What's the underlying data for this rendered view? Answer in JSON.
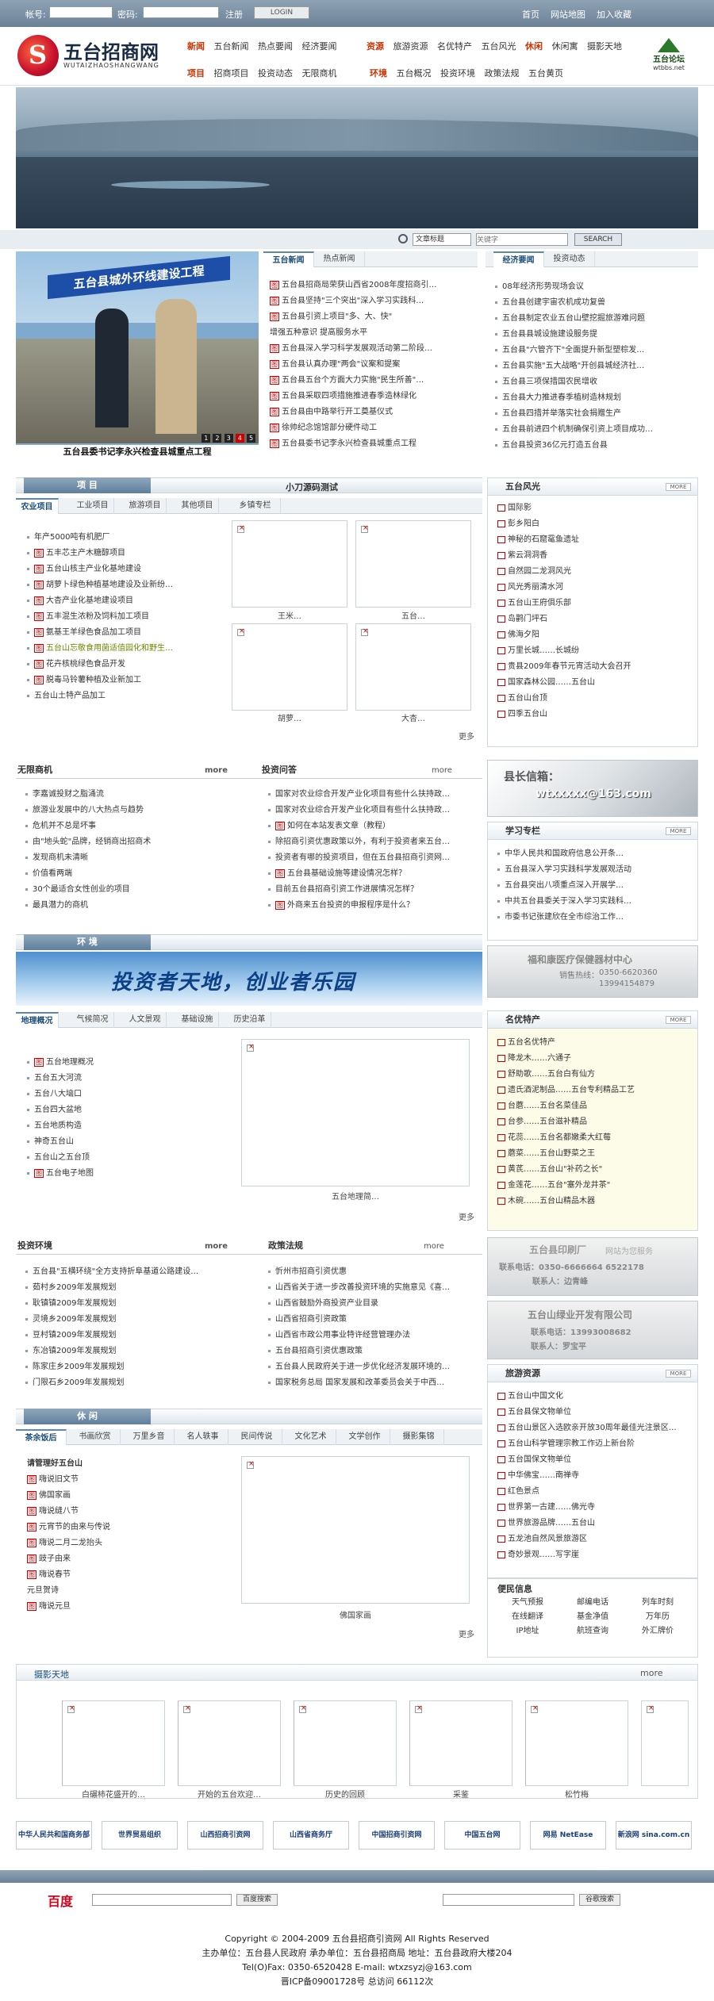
{
  "topbar": {
    "account_label": "帐号:",
    "password_label": "密码:",
    "register": "注册",
    "login": "LOGIN",
    "home": "首页",
    "sitemap": "网站地图",
    "favorite": "加入收藏"
  },
  "header": {
    "logo_title": "五台招商网",
    "logo_sub": "WUTAIZHAOSHANGWANG",
    "nav1_cat": "新闻",
    "nav1": [
      "五台新闻",
      "热点要闻",
      "经济要闻"
    ],
    "nav1b_cat": "资源",
    "nav1b": [
      "旅游资源",
      "名优特产",
      "五台风光"
    ],
    "nav1c_cat": "休闲",
    "nav1c": [
      "休闲寓",
      "摄影天地"
    ],
    "nav2_cat": "项目",
    "nav2": [
      "招商项目",
      "投资动态",
      "无限商机"
    ],
    "nav2b_cat": "环境",
    "nav2b": [
      "五台概况",
      "投资环境",
      "政策法规",
      "五台黄页"
    ],
    "right_logo": "五台论坛",
    "right_logo_sub": "wtbbs.net"
  },
  "search": {
    "select": "文章标题",
    "placeholder": "关键字",
    "button": "SEARCH"
  },
  "photo": {
    "sign": "五台县城外环线建设工程",
    "caption": "五台县委书记李永兴检查县城重点工程",
    "pages": [
      "1",
      "2",
      "3",
      "4",
      "5"
    ],
    "active_page": 3
  },
  "news": {
    "tabs": [
      "五台新闻",
      "热点新闻"
    ],
    "items": [
      {
        "tag": "图",
        "t": "五台县招商局荣获山西省2008年度招商引…"
      },
      {
        "tag": "图",
        "t": "五台县坚持\"三个突出\"深入学习实践科…"
      },
      {
        "tag": "图",
        "t": "五台县引资上项目\"多、大、快\""
      },
      {
        "tag": "",
        "t": "增强五种意识 提高服务水平"
      },
      {
        "tag": "图",
        "t": "五台县深入学习科学发展观活动第二阶段…"
      },
      {
        "tag": "图",
        "t": "五台县认真办理\"两会\"议案和提案"
      },
      {
        "tag": "图",
        "t": "五台县五台个方面大力实施\"民生所善\"…"
      },
      {
        "tag": "图",
        "t": "五台县采取四项措施推进春季造林绿化"
      },
      {
        "tag": "图",
        "t": "五台县由中路举行开工奠基仪式"
      },
      {
        "tag": "图",
        "t": "徐帅纪念馆馆部分硬件动工"
      },
      {
        "tag": "图",
        "t": "五台县委书记李永兴检查县城重点工程"
      }
    ]
  },
  "econ": {
    "tabs": [
      "经济要闻",
      "投资动态"
    ],
    "items": [
      "08年经济形势现场会议",
      "五台县创建宇宙农机成功复兽",
      "五台县制定农业五台山壁挖掘旅游难问题",
      "五台县县城设施建设服务提",
      "五台县\"六管齐下\"全面提升新型塑棕发…",
      "五台县实施\"五大战略\"开创县城经济社…",
      "五台县三项保措国农民增收",
      "五台县大力推进春季植树造林规划",
      "五台县四措并举落实社会捐赠生产",
      "五台县前进四个机制确保引资上项目成功…",
      "五台县投资36亿元打造五台县"
    ]
  },
  "projects": {
    "band": "项  目",
    "center_title": "小刀源码测试",
    "tabs": [
      "农业项目",
      "工业项目",
      "旅游项目",
      "其他项目",
      "乡镇专栏"
    ],
    "items": [
      {
        "tag": "",
        "t": "年产5000吨有机肥厂"
      },
      {
        "tag": "图",
        "t": "五丰芯主产木糖醇项目"
      },
      {
        "tag": "图",
        "t": "五台山核主产业化基地建设"
      },
      {
        "tag": "图",
        "t": "胡萝卜绿色种植基地建设及业新纷…"
      },
      {
        "tag": "图",
        "t": "大杏产业化基地建设项目"
      },
      {
        "tag": "图",
        "t": "五丰混生浓粉及饲料加工项目"
      },
      {
        "tag": "图",
        "t": "氨基王羊绿色食品加工项目"
      },
      {
        "tag": "图",
        "t": "五台山忘敬食用菌适值园化和野生…",
        "hl": true
      },
      {
        "tag": "图",
        "t": "花卉核桃绿色食品开发"
      },
      {
        "tag": "图",
        "t": "脱毒马铃薯种植及业新加工"
      },
      {
        "tag": "",
        "t": "五台山土特产品加工"
      }
    ],
    "thumbs": [
      "王米…",
      "五台…",
      "胡萝…",
      "大杏…"
    ],
    "more": "更多"
  },
  "scenic": {
    "title": "五台风光",
    "morebtn": "MORE",
    "items": [
      "国际影",
      "彭乡阳白",
      "神秘的石窟鼋鱼遗址",
      "紫云洞洞香",
      "自然园二龙洞风光",
      "风光秀丽清水河",
      "五台山王府俱乐部",
      "岛鹳门坪石",
      "佛海夕阳",
      "万里长城……长城纷",
      "贵县2009年春节元宵活动大会召开",
      "国家森林公园……五台山",
      "五台山台顶",
      "四季五台山"
    ]
  },
  "opps": {
    "title": "无限商机",
    "more": "more",
    "items": [
      "李嘉诚投财之脂涌流",
      "旅游业发展中的八大热点与趋势",
      "危机并不总是坏事",
      "由\"地头蛇\"品牌，经销商出招商术",
      "发现商机未清晰",
      "价值看两端",
      "30个最适合女性创业的项目",
      "最具潜力的商机"
    ]
  },
  "invq": {
    "title": "投资问答",
    "more": "more",
    "items": [
      {
        "tag": "",
        "t": "国家对农业综合开发产业化项目有些什么扶持政…"
      },
      {
        "tag": "",
        "t": "国家对农业综合开发产业化项目有些什么扶持政…"
      },
      {
        "tag": "图",
        "t": "如何在本站发表文章（教程）"
      },
      {
        "tag": "",
        "t": "除招商引资优惠政策以外，有利于投资者来五台…"
      },
      {
        "tag": "",
        "t": "投资者有哪的投资项目，但在五台县招商引资网…"
      },
      {
        "tag": "图",
        "t": "五台县基础设施等建设情况怎样？"
      },
      {
        "tag": "",
        "t": "目前五台县招商引资工作进展情况怎样？"
      },
      {
        "tag": "图",
        "t": "外商来五台投资的申报程序是什么？"
      }
    ]
  },
  "ad1": {
    "title": "县长信箱：",
    "email": "wtxxxxx@163.com"
  },
  "study": {
    "title": "学习专栏",
    "morebtn": "MORE",
    "items": [
      "中华人民共和国政府信息公开条…",
      "五台县深入学习实践科学发展观活动",
      "五台县突出八项重点深入开展学…",
      "中共五台县委关于深入学习实践科…",
      "市委书记张建欣在全市综治工作…"
    ]
  },
  "ad2": {
    "title": "福和康医疗保健器材中心",
    "line1": "销售热线：",
    "tel1": "0350-6620360",
    "tel2": "13994154879"
  },
  "env_band": "环  境",
  "env_banner": "投资者天地，创业者乐园",
  "geo": {
    "tabs": [
      "地理概况",
      "气候简况",
      "人文景观",
      "基础设施",
      "历史沿革"
    ],
    "items": [
      {
        "tag": "图",
        "t": "五台地理概况"
      },
      {
        "tag": "",
        "t": "五台五大河流"
      },
      {
        "tag": "",
        "t": "五台八大垴口"
      },
      {
        "tag": "",
        "t": "五台四大盆地"
      },
      {
        "tag": "",
        "t": "五台地质构造"
      },
      {
        "tag": "",
        "t": "神奇五台山"
      },
      {
        "tag": "",
        "t": "五台山之五台顶"
      },
      {
        "tag": "图",
        "t": "五台电子地图"
      }
    ],
    "thumb": "五台地理简…",
    "more": "更多"
  },
  "products": {
    "title": "名优特产",
    "morebtn": "MORE",
    "items": [
      "五台名优特产",
      "降龙木……六通子",
      "舒助歌……五台白有仙方",
      "遗氏酒泥制品……五台专利精品工艺",
      "台蘑……五台名菜佳品",
      "台参……五台滋补精品",
      "花蕊……五台名都嫩柔大红莓",
      "蘑菜……五台山野菜之王",
      "黄芪……五台山\"补药之长\"",
      "金莲花……五台\"塞外龙井茶\"",
      "木碗……五台山精品木器"
    ]
  },
  "envq": {
    "title": "投资环境",
    "more": "more",
    "items": [
      "五台县\"五横环绕\"全方支持折阜基道公路建设…",
      "茹村乡2009年发展规划",
      "耿镇镇2009年发展规划",
      "灵境乡2009年发展规划",
      "豆村镇2009年发展规划",
      "东冶镇2009年发展规划",
      "陈家庄乡2009年发展规划",
      "门限石乡2009年发展规划"
    ]
  },
  "policy": {
    "title": "政策法规",
    "more": "more",
    "items": [
      "忻州市招商引资优惠",
      "山西省关于进一步改善投资环境的实施意见《喜…",
      "山西省鼓励外商投资产业目录",
      "山西省招商引资政策",
      "山西省市政公用事业特许经营管理办法",
      "五台县招商引资优惠政策",
      "五台县人民政府关于进一步优化经济发展环境的…",
      "国家税务总局 国家发展和改革委员会关于中西…"
    ]
  },
  "ad3": {
    "title": "五台县印刷厂",
    "line1": "网站为您服务",
    "line2": "联系电话：0350-6666664 6522178",
    "line3": "联系人：边青峰"
  },
  "ad4": {
    "title": "五台山绿业开发有限公司",
    "line1": "联系电话：13993008682",
    "line2": "联系人：罗宝平"
  },
  "tour": {
    "title": "旅游资源",
    "morebtn": "MORE",
    "items": [
      "五台山中国文化",
      "五台县保文物单位",
      "五台山景区入选欧亲开放30周年最佳光注景区…",
      "五台山科学管理宗教工作迈上新台阶",
      "五台国保文物单位",
      "中华佛宝……南禅寺",
      "红色景点",
      "世界第一古建……佛光寺",
      "世界旅游品牌……五台山",
      "五龙池自然风景旅游区",
      "奇妙景观……写字崖"
    ]
  },
  "conv": {
    "title": "便民信息",
    "items": [
      "天气预报",
      "邮编电话",
      "列车时刻",
      "在线翻译",
      "基金净值",
      "万年历",
      "IP地址",
      "航班查询",
      "外汇牌价"
    ]
  },
  "leisure": {
    "band": "休  闲",
    "tabs": [
      "茶余饭后",
      "书画欣赏",
      "万里乡音",
      "名人轶事",
      "民间传说",
      "文化艺术",
      "文学创作",
      "摄影集锦"
    ],
    "items": [
      {
        "tag": "",
        "t": "请管理好五台山",
        "b": true
      },
      {
        "tag": "图",
        "t": "嗨说旧文节"
      },
      {
        "tag": "图",
        "t": "佛国家画"
      },
      {
        "tag": "图",
        "t": "嗨说缝八节"
      },
      {
        "tag": "图",
        "t": "元宵节的由来与传说"
      },
      {
        "tag": "图",
        "t": "嗨说二月二龙抬头"
      },
      {
        "tag": "图",
        "t": "豉子由来"
      },
      {
        "tag": "图",
        "t": "嗨说春节"
      },
      {
        "tag": "",
        "t": "元旦贺诗"
      },
      {
        "tag": "图",
        "t": "嗨说元旦"
      }
    ],
    "thumb": "佛国家画",
    "more": "更多"
  },
  "photos": {
    "title": "摄影天地",
    "more": "more",
    "items": [
      "白碾柿花盛开的…",
      "开始的五台欢迎…",
      "历史的回顾",
      "采鉴",
      "松竹梅"
    ]
  },
  "links": [
    "中华人民共和国商务部",
    "世界贸易组织",
    "山西招商引资网",
    "山西省商务厅",
    "中国招商引资网",
    "中国五台网",
    "网易 NetEase",
    "新浪网 sina.com.cn"
  ],
  "bottom": {
    "baidu": "百度",
    "btn1": "百度搜索",
    "btn2": "谷歌搜索"
  },
  "footer": {
    "copyright": "Copyright © 2004-2009 五台县招商引资网 All Rights Reserved",
    "line2": "主办单位：五台县人民政府   承办单位：五台县招商局   地址：五台县政府大楼204",
    "line3": "Tel(O)Fax: 0350-6520428 E-mail: wtxzsyzj@163.com",
    "line4": "晋ICP备09001728号   总访问 66112次"
  }
}
